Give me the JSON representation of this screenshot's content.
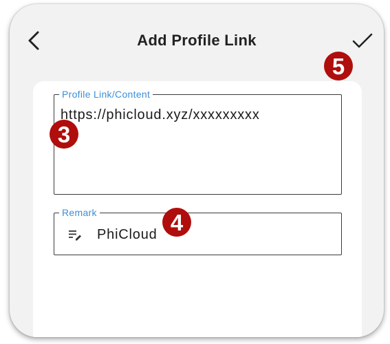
{
  "appbar": {
    "title": "Add Profile Link",
    "back_icon": "chevron-left-icon",
    "confirm_icon": "check-icon"
  },
  "form": {
    "link_field": {
      "label": "Profile Link/Content",
      "value": "https://phicloud.xyz/xxxxxxxxx"
    },
    "remark_field": {
      "label": "Remark",
      "icon": "edit-note-icon",
      "value": "PhiCloud"
    }
  },
  "markers": {
    "step3": "3",
    "step4": "4",
    "step5": "5"
  },
  "colors": {
    "label_accent": "#3a8ed8",
    "marker_red": "#b00d0d",
    "background": "#f2f2f2"
  }
}
